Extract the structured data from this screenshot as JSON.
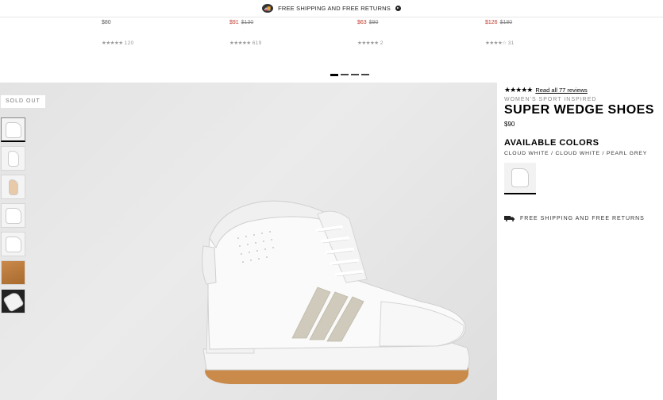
{
  "topbar": {
    "shipping_text": "FREE SHIPPING AND FREE RETURNS"
  },
  "recommendations": [
    {
      "price": "$80",
      "old_price": "",
      "review_count": "120"
    },
    {
      "price": "$91",
      "old_price": "$130",
      "review_count": "619"
    },
    {
      "price": "$63",
      "old_price": "$90",
      "review_count": "2"
    },
    {
      "price": "$126",
      "old_price": "$180",
      "review_count": "31"
    }
  ],
  "hero": {
    "sold_out": "SOLD OUT"
  },
  "product": {
    "rating": 4.5,
    "reviews_link": "Read all 77 reviews",
    "subtitle": "WOMEN'S SPORT INSPIRED",
    "title": "SUPER WEDGE SHOES",
    "price": "$90",
    "colors_heading": "AVAILABLE COLORS",
    "color_name": "CLOUD WHITE / CLOUD WHITE / PEARL GREY",
    "shipping_note": "FREE SHIPPING AND FREE RETURNS"
  },
  "colors": {
    "sale": "#c0392b",
    "stripe": "#cfcabb",
    "sole_gum": "#c98a4a"
  }
}
